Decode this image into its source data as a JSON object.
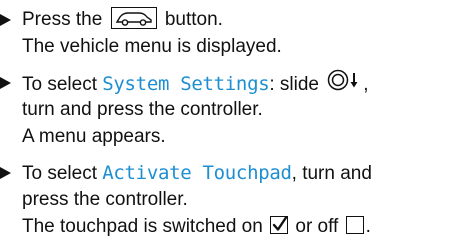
{
  "steps": [
    {
      "pre": "Press the",
      "icon": "car-icon",
      "post": "button.",
      "result": "The vehicle menu is displayed."
    },
    {
      "pre": "To select",
      "highlight": "System Settings",
      "post": ": slide",
      "icon": "controller-slide-down-icon",
      "post2": ",",
      "line2": "turn and press the controller.",
      "result": "A menu appears."
    },
    {
      "pre": "To select",
      "highlight": "Activate Touchpad",
      "post": ", turn and",
      "line2": "press the controller.",
      "result_pre": "The touchpad is switched on",
      "checked_icon": "checkbox-checked-icon",
      "result_mid": "or off",
      "unchecked_icon": "checkbox-unchecked-icon",
      "result_end": "."
    }
  ],
  "colors": {
    "highlight": "#1d8fd0",
    "text": "#111111"
  }
}
